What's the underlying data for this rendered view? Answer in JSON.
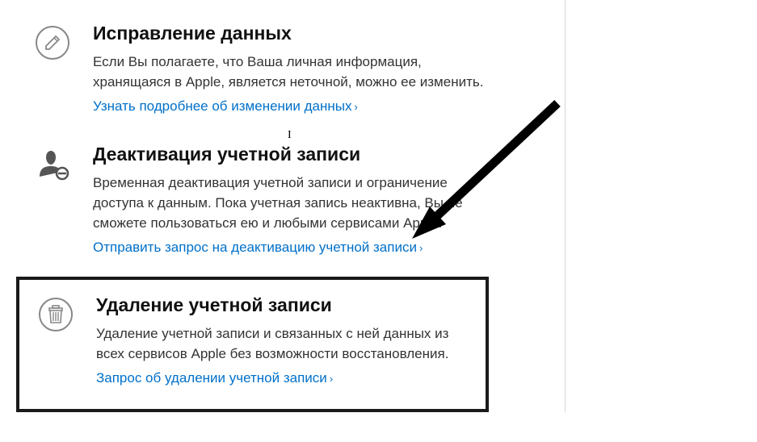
{
  "sections": {
    "correct": {
      "title": "Исправление данных",
      "desc": "Если Вы полагаете, что Ваша личная информация, хранящаяся в Apple, является неточной, можно ее изменить.",
      "link": "Узнать подробнее об изменении данных"
    },
    "deactivate": {
      "title": "Деактивация учетной записи",
      "desc": "Временная деактивация учетной записи и ограничение доступа к данным. Пока учетная запись неактивна, Вы не сможете пользоваться ею и любыми сервисами Apple.",
      "link": "Отправить запрос на деактивацию учетной записи"
    },
    "delete": {
      "title": "Удаление учетной записи",
      "desc": "Удаление учетной записи и связанных с ней данных из всех сервисов Apple без возможности восстановления.",
      "link": "Запрос об удалении учетной записи"
    }
  },
  "chevron": "›"
}
